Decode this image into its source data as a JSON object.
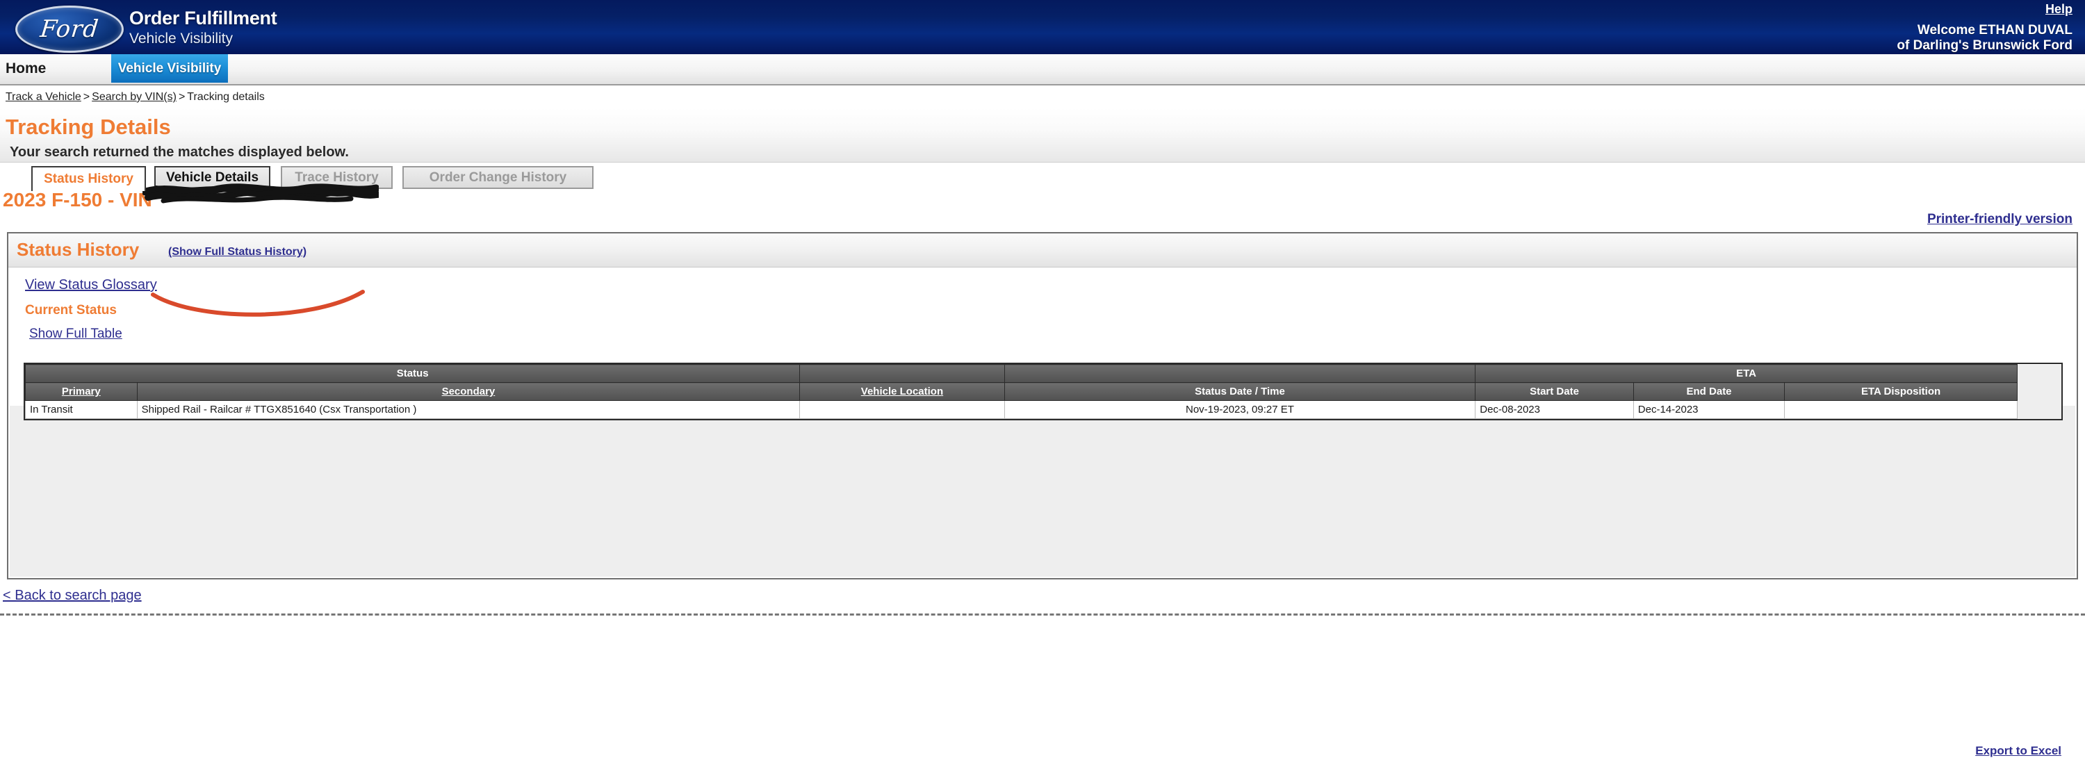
{
  "header": {
    "brand_logo_text": "Ford",
    "app_title": "Order Fulfillment",
    "app_subtitle": "Vehicle Visibility",
    "help_label": "Help",
    "welcome_line1": "Welcome ETHAN DUVAL",
    "welcome_line2": "of Darling's Brunswick Ford",
    "bg_color": "#052066"
  },
  "nav": {
    "home_label": "Home",
    "active_tab_label": "Vehicle Visibility",
    "active_tab_color": "#1d8fd8"
  },
  "breadcrumb": {
    "item1": "Track a Vehicle",
    "sep1": ">",
    "item2": "Search by VIN(s)",
    "sep2": ">",
    "item3": "Tracking details"
  },
  "page": {
    "title": "Tracking Details",
    "title_color": "#ef7c34",
    "message": "Your search returned the matches displayed below.",
    "printer_friendly_label": "Printer-friendly version",
    "back_link_label": "< Back to search page"
  },
  "tabs": [
    {
      "label": "Status History",
      "state": "active"
    },
    {
      "label": "Vehicle Details",
      "state": "enabled"
    },
    {
      "label": "Trace History",
      "state": "disabled"
    },
    {
      "label": "Order Change History",
      "state": "disabled"
    }
  ],
  "vehicle": {
    "heading": "2023 F-150 - VIN",
    "vin_redacted": true
  },
  "status_panel": {
    "title": "Status History",
    "show_full_link": "(Show Full Status History)",
    "glossary_link": "View Status Glossary",
    "current_status_label": "Current Status",
    "show_full_table_link": "Show Full Table",
    "export_label": "Export to Excel"
  },
  "table": {
    "group_headers": [
      {
        "label": "Status",
        "span": 2
      },
      {
        "label": "",
        "span": 1
      },
      {
        "label": "",
        "span": 1
      },
      {
        "label": "ETA",
        "span": 3
      },
      {
        "label": "",
        "span": 1
      }
    ],
    "columns": [
      {
        "label": "Primary",
        "sortable": true
      },
      {
        "label": "Secondary",
        "sortable": true
      },
      {
        "label": "Vehicle Location",
        "sortable": true
      },
      {
        "label": "Status Date / Time",
        "sortable": false
      },
      {
        "label": "Start Date",
        "sortable": false
      },
      {
        "label": "End Date",
        "sortable": false
      },
      {
        "label": "ETA Disposition",
        "sortable": false
      }
    ],
    "rows": [
      {
        "primary": "In Transit",
        "secondary": "Shipped Rail - Railcar # TTGX851640 (Csx Transportation )",
        "vehicle_location": "",
        "status_date_time": "Nov-19-2023, 09:27 ET",
        "eta_start_date": "Dec-08-2023",
        "eta_end_date": "Dec-14-2023",
        "eta_disposition": ""
      }
    ]
  },
  "annotations": {
    "underline_color": "#d94a2b",
    "redaction_color": "#111111"
  }
}
